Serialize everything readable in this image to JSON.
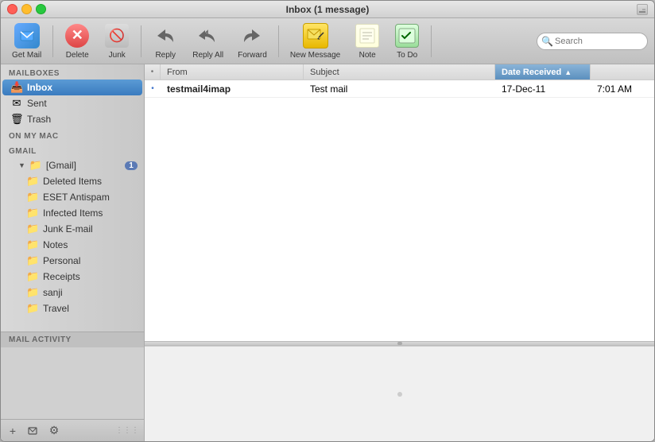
{
  "window": {
    "title": "Inbox (1 message)"
  },
  "toolbar": {
    "get_mail_label": "Get Mail",
    "delete_label": "Delete",
    "junk_label": "Junk",
    "reply_label": "Reply",
    "reply_all_label": "Reply All",
    "forward_label": "Forward",
    "new_message_label": "New Message",
    "note_label": "Note",
    "todo_label": "To Do",
    "search_placeholder": "Search",
    "search_label": "Search"
  },
  "sidebar": {
    "mailboxes_header": "MAILBOXES",
    "on_my_mac_header": "ON MY MAC",
    "gmail_header": "GMAIL",
    "mail_activity_header": "MAIL ACTIVITY",
    "mailboxes": [
      {
        "id": "inbox",
        "label": "Inbox",
        "icon": "📥",
        "active": true
      },
      {
        "id": "sent",
        "label": "Sent",
        "icon": "✉",
        "active": false
      },
      {
        "id": "trash",
        "label": "Trash",
        "icon": "🗑",
        "active": false
      }
    ],
    "gmail_folders": [
      {
        "id": "gmail-root",
        "label": "[Gmail]",
        "icon": "▶",
        "badge": "1",
        "indent": 1
      },
      {
        "id": "deleted-items",
        "label": "Deleted Items",
        "icon": "📁",
        "indent": 2
      },
      {
        "id": "eset-antispam",
        "label": "ESET Antispam",
        "icon": "📁",
        "indent": 2
      },
      {
        "id": "infected-items",
        "label": "Infected Items",
        "icon": "📁",
        "indent": 2
      },
      {
        "id": "junk-email",
        "label": "Junk E-mail",
        "icon": "📁",
        "indent": 2
      },
      {
        "id": "notes",
        "label": "Notes",
        "icon": "📁",
        "indent": 2
      },
      {
        "id": "personal",
        "label": "Personal",
        "icon": "📁",
        "indent": 2
      },
      {
        "id": "receipts",
        "label": "Receipts",
        "icon": "📁",
        "indent": 2
      },
      {
        "id": "sanji",
        "label": "sanji",
        "icon": "📁",
        "indent": 2
      },
      {
        "id": "travel",
        "label": "Travel",
        "icon": "📁",
        "indent": 2
      }
    ],
    "bottom_buttons": [
      {
        "id": "add",
        "label": "+",
        "icon": "+"
      },
      {
        "id": "compose",
        "label": "compose",
        "icon": "✏"
      },
      {
        "id": "settings",
        "label": "settings",
        "icon": "⚙"
      }
    ]
  },
  "email_list": {
    "columns": [
      {
        "id": "dot",
        "label": "•"
      },
      {
        "id": "from",
        "label": "From"
      },
      {
        "id": "subject",
        "label": "Subject"
      },
      {
        "id": "date_received",
        "label": "Date Received",
        "active": true
      },
      {
        "id": "time",
        "label": ""
      }
    ],
    "rows": [
      {
        "dot": "•",
        "from": "testmail4imap",
        "subject": "Test mail",
        "date": "17-Dec-11",
        "time": "7:01 AM"
      }
    ]
  }
}
